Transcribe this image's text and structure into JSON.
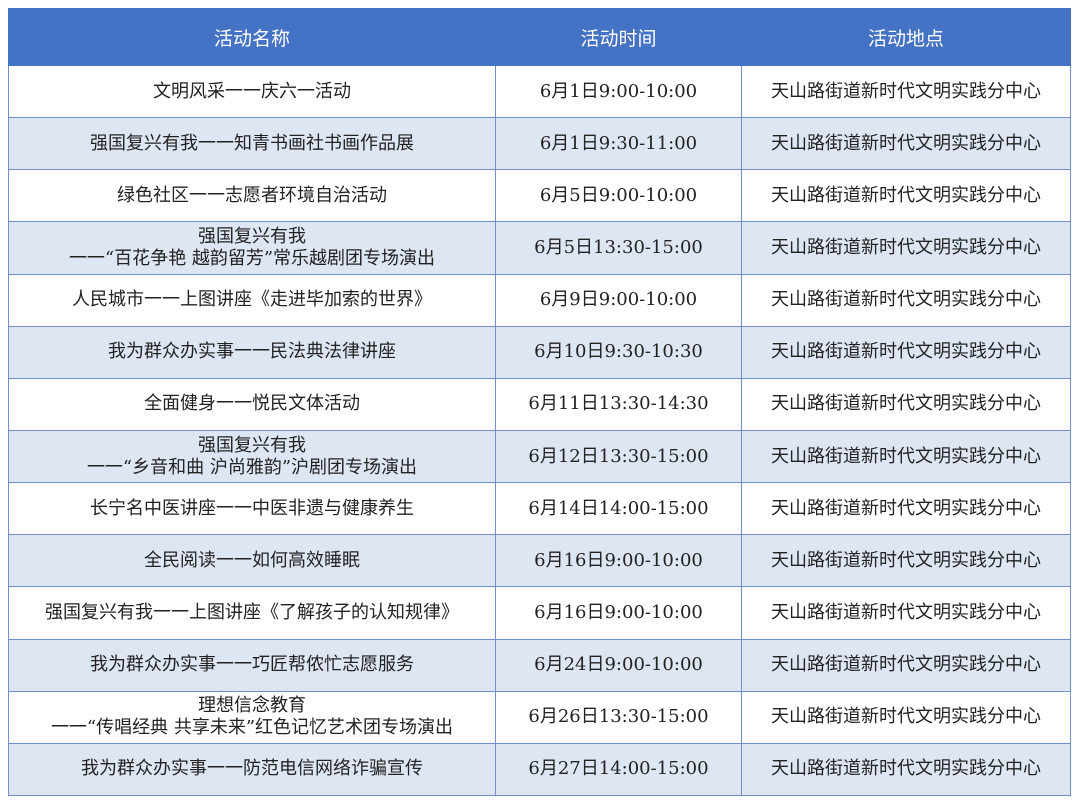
{
  "table": {
    "headers": [
      "活动名称",
      "活动时间",
      "活动地点"
    ],
    "rows": [
      {
        "name": [
          "文明风采一一庆六一活动"
        ],
        "time": "6月1日9:00-10:00",
        "place": "天山路街道新时代文明实践分中心"
      },
      {
        "name": [
          "强国复兴有我一一知青书画社书画作品展"
        ],
        "time": "6月1日9:30-11:00",
        "place": "天山路街道新时代文明实践分中心"
      },
      {
        "name": [
          "绿色社区一一志愿者环境自治活动"
        ],
        "time": "6月5日9:00-10:00",
        "place": "天山路街道新时代文明实践分中心"
      },
      {
        "name": [
          "强国复兴有我",
          "一一“百花争艳 越韵留芳”常乐越剧团专场演出"
        ],
        "time": "6月5日13:30-15:00",
        "place": "天山路街道新时代文明实践分中心"
      },
      {
        "name": [
          "人民城市一一上图讲座《走进毕加索的世界》"
        ],
        "time": "6月9日9:00-10:00",
        "place": "天山路街道新时代文明实践分中心"
      },
      {
        "name": [
          "我为群众办实事一一民法典法律讲座"
        ],
        "time": "6月10日9:30-10:30",
        "place": "天山路街道新时代文明实践分中心"
      },
      {
        "name": [
          "全面健身一一悦民文体活动"
        ],
        "time": "6月11日13:30-14:30",
        "place": "天山路街道新时代文明实践分中心"
      },
      {
        "name": [
          "强国复兴有我",
          "一一“乡音和曲 沪尚雅韵”沪剧团专场演出"
        ],
        "time": "6月12日13:30-15:00",
        "place": "天山路街道新时代文明实践分中心"
      },
      {
        "name": [
          "长宁名中医讲座一一中医非遗与健康养生"
        ],
        "time": "6月14日14:00-15:00",
        "place": "天山路街道新时代文明实践分中心"
      },
      {
        "name": [
          "全民阅读一一如何高效睡眠"
        ],
        "time": "6月16日9:00-10:00",
        "place": "天山路街道新时代文明实践分中心"
      },
      {
        "name": [
          "强国复兴有我一一上图讲座《了解孩子的认知规律》"
        ],
        "time": "6月16日9:00-10:00",
        "place": "天山路街道新时代文明实践分中心"
      },
      {
        "name": [
          "我为群众办实事一一巧匠帮侬忙志愿服务"
        ],
        "time": "6月24日9:00-10:00",
        "place": "天山路街道新时代文明实践分中心"
      },
      {
        "name": [
          "理想信念教育",
          "一一“传唱经典 共享未来”红色记忆艺术团专场演出"
        ],
        "time": "6月26日13:30-15:00",
        "place": "天山路街道新时代文明实践分中心"
      },
      {
        "name": [
          "我为群众办实事一一防范电信网络诈骗宣传"
        ],
        "time": "6月27日14:00-15:00",
        "place": "天山路街道新时代文明实践分中心"
      }
    ]
  },
  "colors": {
    "header_bg": "#4472c4",
    "header_text": "#ffffff",
    "stripe_bg": "#dfe6f3",
    "border": "#6f8fcf"
  }
}
